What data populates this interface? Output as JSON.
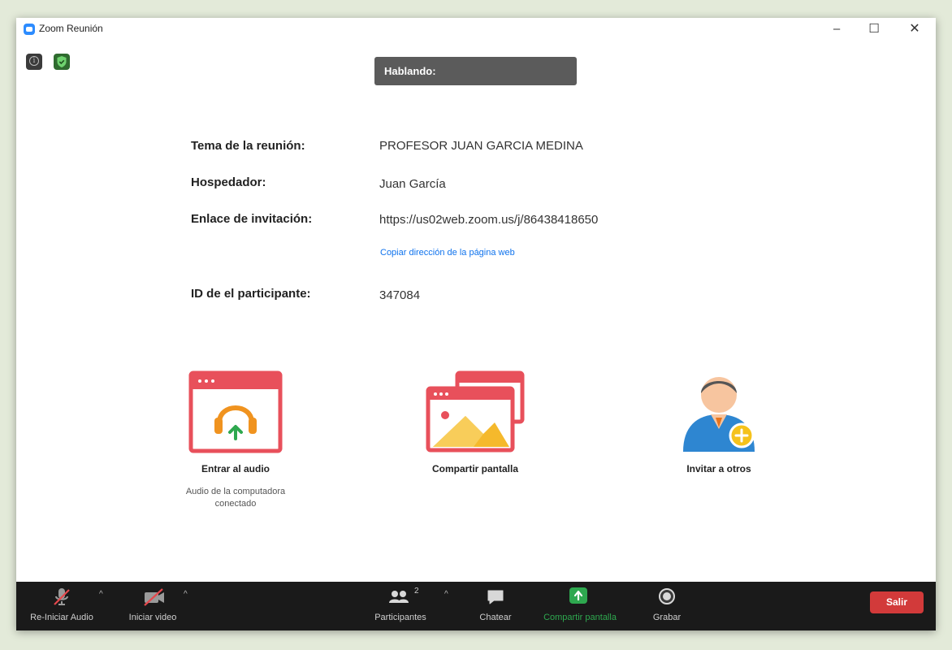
{
  "window": {
    "title": "Zoom Reunión",
    "controls": {
      "minimize": "–",
      "maximize": "☐",
      "close": "✕"
    }
  },
  "status": {
    "speaking_label": "Hablando:"
  },
  "meeting_info": {
    "topic_label": "Tema de la reunión:",
    "topic_value": "PROFESOR JUAN GARCIA MEDINA",
    "host_label": "Hospedador:",
    "host_value": "Juan García",
    "invite_label": "Enlace de invitación:",
    "invite_value": "https://us02web.zoom.us/j/86438418650",
    "copy_link_label": "Copiar dirección de la página web",
    "participant_id_label": "ID de el participante:",
    "participant_id_value": "347084"
  },
  "actions": {
    "join_audio": {
      "label": "Entrar al audio",
      "sublabel_line1": "Audio de la computadora",
      "sublabel_line2": "conectado"
    },
    "share_screen": {
      "label": "Compartir pantalla"
    },
    "invite_others": {
      "label": "Invitar a otros"
    }
  },
  "toolbar": {
    "audio_label": "Re-Iniciar Audio",
    "video_label": "Iniciar video",
    "participants_label": "Participantes",
    "participants_count": "2",
    "chat_label": "Chatear",
    "share_label": "Compartir pantalla",
    "record_label": "Grabar",
    "leave_label": "Salir"
  },
  "colors": {
    "accent_green": "#2ea84f",
    "leave_red": "#d23a3a",
    "link_blue": "#0e72ed",
    "action_red": "#e8505b"
  }
}
